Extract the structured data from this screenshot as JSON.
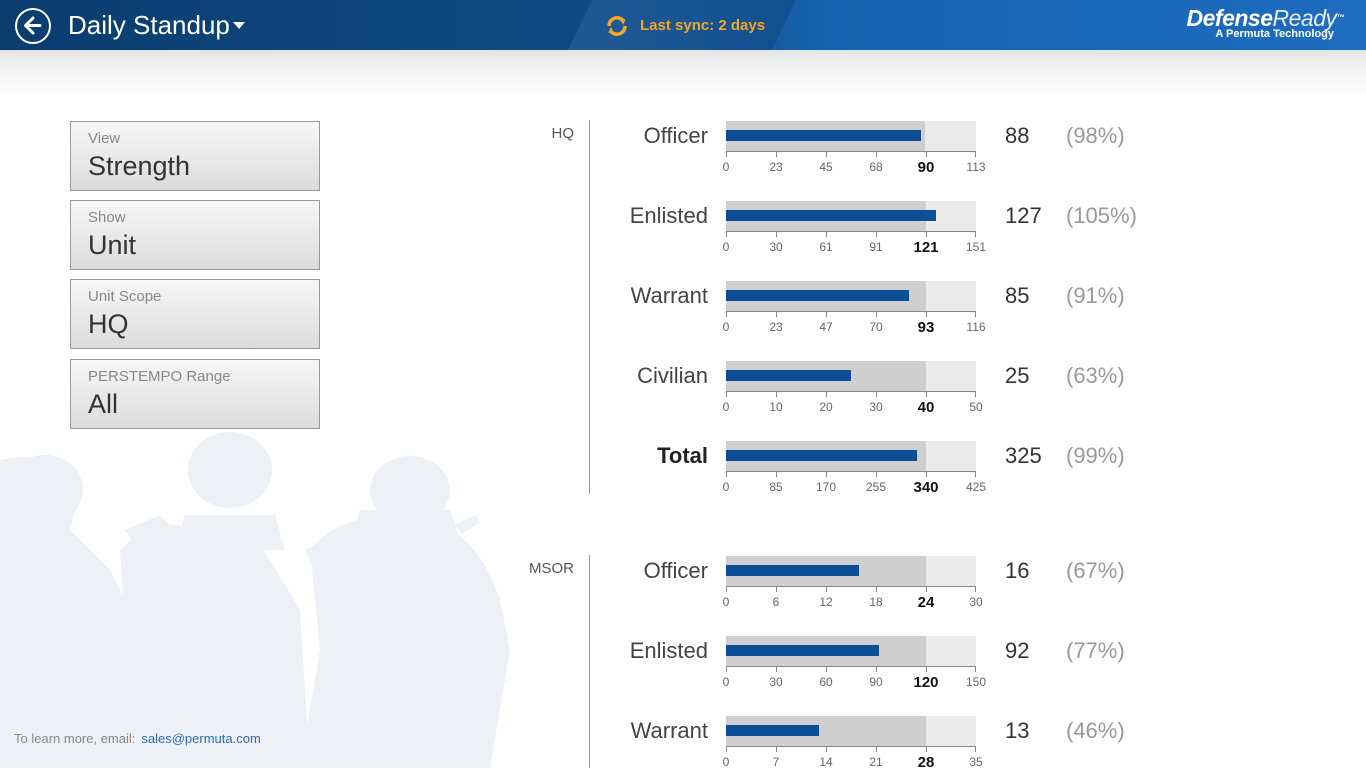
{
  "header": {
    "title": "Daily Standup",
    "sync_text": "Last sync: 2 days",
    "brand_name_1": "Defense",
    "brand_name_2": "Ready",
    "brand_tm": "™",
    "brand_sub": "A Permuta Technology"
  },
  "filters": [
    {
      "label": "View",
      "value": "Strength"
    },
    {
      "label": "Show",
      "value": "Unit"
    },
    {
      "label": "Unit Scope",
      "value": "HQ"
    },
    {
      "label": "PERSTEMPO Range",
      "value": "All"
    }
  ],
  "footer": {
    "text": "To learn more, email:",
    "email": "sales@permuta.com"
  },
  "colors": {
    "accent": "#0c4f96",
    "sync": "#f5a623",
    "header_dark": "#0a3d6e"
  },
  "chart_data": {
    "type": "bar",
    "sections": [
      {
        "name": "HQ",
        "rows": [
          {
            "category": "Officer",
            "actual": 88,
            "target": 90,
            "max": 113,
            "ticks": [
              "0",
              "23",
              "45",
              "68",
              "90",
              "113"
            ],
            "count": "88",
            "percent": "(98%)"
          },
          {
            "category": "Enlisted",
            "actual": 127,
            "target": 121,
            "max": 151,
            "ticks": [
              "0",
              "30",
              "61",
              "91",
              "121",
              "151"
            ],
            "count": "127",
            "percent": "(105%)"
          },
          {
            "category": "Warrant",
            "actual": 85,
            "target": 93,
            "max": 116,
            "ticks": [
              "0",
              "23",
              "47",
              "70",
              "93",
              "116"
            ],
            "count": "85",
            "percent": "(91%)"
          },
          {
            "category": "Civilian",
            "actual": 25,
            "target": 40,
            "max": 50,
            "ticks": [
              "0",
              "10",
              "20",
              "30",
              "40",
              "50"
            ],
            "count": "25",
            "percent": "(63%)"
          },
          {
            "category": "Total",
            "actual": 325,
            "target": 340,
            "max": 425,
            "ticks": [
              "0",
              "85",
              "170",
              "255",
              "340",
              "425"
            ],
            "count": "325",
            "percent": "(99%)",
            "bold": true
          }
        ]
      },
      {
        "name": "MSOR",
        "rows": [
          {
            "category": "Officer",
            "actual": 16,
            "target": 24,
            "max": 30,
            "ticks": [
              "0",
              "6",
              "12",
              "18",
              "24",
              "30"
            ],
            "count": "16",
            "percent": "(67%)"
          },
          {
            "category": "Enlisted",
            "actual": 92,
            "target": 120,
            "max": 150,
            "ticks": [
              "0",
              "30",
              "60",
              "90",
              "120",
              "150"
            ],
            "count": "92",
            "percent": "(77%)"
          },
          {
            "category": "Warrant",
            "actual": 13,
            "target": 28,
            "max": 35,
            "ticks": [
              "0",
              "7",
              "14",
              "21",
              "28",
              "35"
            ],
            "count": "13",
            "percent": "(46%)"
          }
        ]
      }
    ]
  }
}
